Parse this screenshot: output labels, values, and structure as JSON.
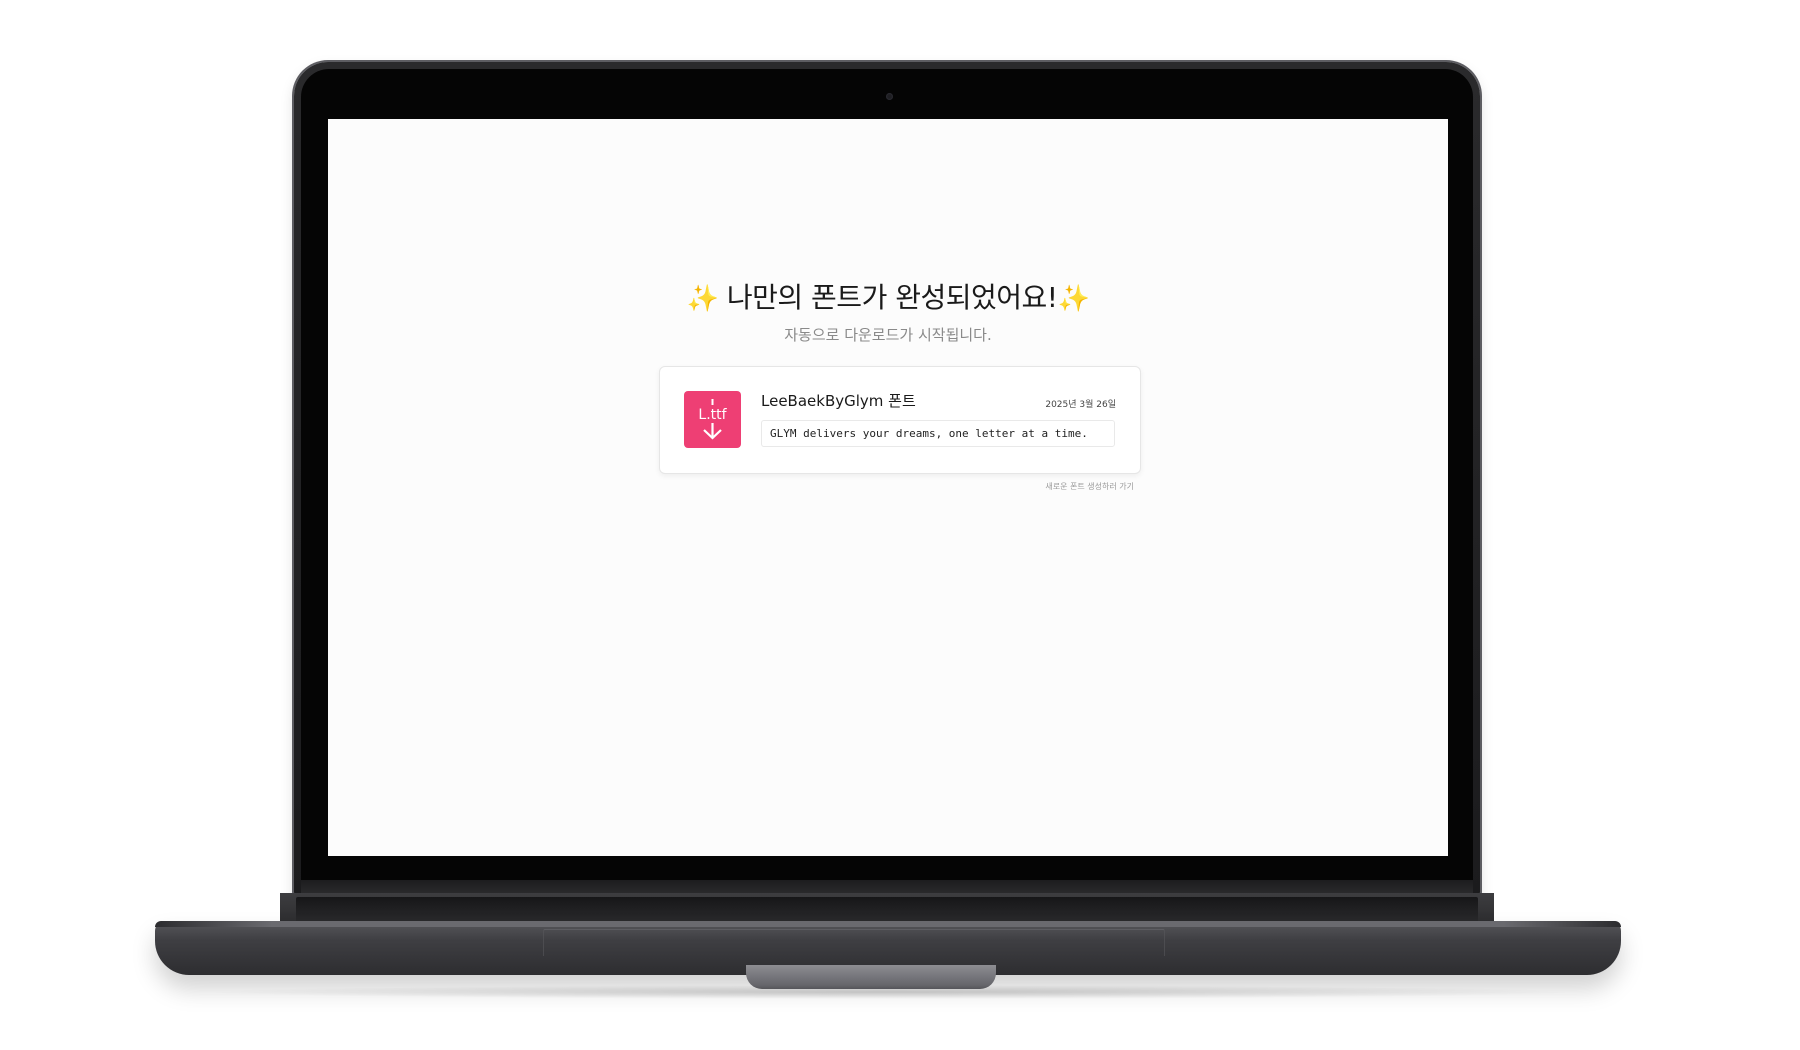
{
  "hero": {
    "sparkle_left": "✨",
    "title": " 나만의 폰트가 완성되었어요!",
    "sparkle_right": "✨",
    "subtitle": "자동으로 다운로드가 시작됩니다."
  },
  "font_card": {
    "icon_label": "L.ttf",
    "name": "LeeBaekByGlym 폰트",
    "date": "2025년 3월 26일",
    "preview_text": "GLYM delivers your dreams, one letter at a time."
  },
  "links": {
    "create_new": "새로운 폰트 생성하러 가기"
  },
  "colors": {
    "accent": "#ee3f74",
    "sparkle": "#f3d47a",
    "screen_bg": "#fcfcfc"
  },
  "icons": {
    "file_icon": "ttf-download-icon",
    "camera": "camera-dot"
  }
}
